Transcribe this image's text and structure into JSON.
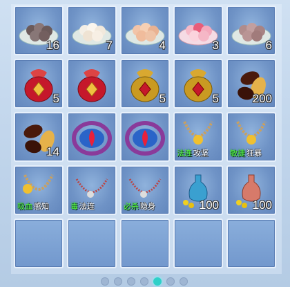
{
  "slots": [
    {
      "icon": "dumpling-plate-icon",
      "qty": "16",
      "tagA": "",
      "tagB": ""
    },
    {
      "icon": "dumpling-plate-icon",
      "qty": "7",
      "tagA": "",
      "tagB": ""
    },
    {
      "icon": "dumpling-plate-icon",
      "qty": "4",
      "tagA": "",
      "tagB": ""
    },
    {
      "icon": "dumpling-plate-icon",
      "qty": "3",
      "tagA": "",
      "tagB": ""
    },
    {
      "icon": "dumpling-plate-icon",
      "qty": "6",
      "tagA": "",
      "tagB": ""
    },
    {
      "icon": "red-pouch-icon",
      "qty": "5",
      "tagA": "",
      "tagB": ""
    },
    {
      "icon": "red-pouch-icon",
      "qty": "",
      "tagA": "",
      "tagB": ""
    },
    {
      "icon": "gold-pouch-icon",
      "qty": "5",
      "tagA": "",
      "tagB": ""
    },
    {
      "icon": "gold-pouch-icon",
      "qty": "5",
      "tagA": "",
      "tagB": ""
    },
    {
      "icon": "seeds-icon",
      "qty": "200",
      "tagA": "",
      "tagB": ""
    },
    {
      "icon": "seeds-icon",
      "qty": "14",
      "tagA": "",
      "tagB": ""
    },
    {
      "icon": "flame-crest-icon",
      "qty": "",
      "tagA": "",
      "tagB": ""
    },
    {
      "icon": "flame-crest-icon",
      "qty": "",
      "tagA": "",
      "tagB": ""
    },
    {
      "icon": "bead-necklace-icon",
      "qty": "",
      "tagA": "法连",
      "tagB": "攻坚"
    },
    {
      "icon": "bead-necklace-icon",
      "qty": "",
      "tagA": "敏捷",
      "tagB": "狂暴"
    },
    {
      "icon": "bead-necklace-icon",
      "qty": "",
      "tagA": "吸血",
      "tagB": "感知"
    },
    {
      "icon": "bead-necklace-icon",
      "qty": "",
      "tagA": "毒",
      "tagB": "法连"
    },
    {
      "icon": "bead-necklace-icon",
      "qty": "",
      "tagA": "必杀",
      "tagB": "隐身"
    },
    {
      "icon": "vase-coins-icon",
      "qty": "100",
      "tagA": "",
      "tagB": ""
    },
    {
      "icon": "vase-coins-icon",
      "qty": "100",
      "tagA": "",
      "tagB": ""
    },
    {
      "icon": "",
      "qty": "",
      "tagA": "",
      "tagB": ""
    },
    {
      "icon": "",
      "qty": "",
      "tagA": "",
      "tagB": ""
    },
    {
      "icon": "",
      "qty": "",
      "tagA": "",
      "tagB": ""
    },
    {
      "icon": "",
      "qty": "",
      "tagA": "",
      "tagB": ""
    },
    {
      "icon": "",
      "qty": "",
      "tagA": "",
      "tagB": ""
    }
  ],
  "pagination": {
    "pages": 7,
    "active_index": 4
  }
}
